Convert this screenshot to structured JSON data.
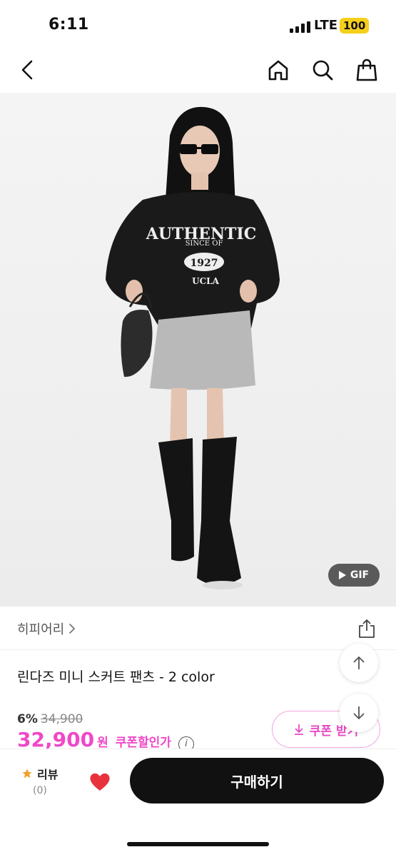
{
  "status_bar": {
    "time": "6:11",
    "network": "LTE",
    "battery": "100"
  },
  "nav": {
    "back_icon": "chevron-left",
    "home_icon": "home",
    "search_icon": "search",
    "cart_icon": "shopping-bag"
  },
  "hero": {
    "gif_label": "GIF",
    "shirt_line1": "AUTHENTIC",
    "shirt_line2": "SINCE OF",
    "shirt_line3": "1927",
    "shirt_line4": "UCLA"
  },
  "product": {
    "brand": "히피어리",
    "title": "린다즈 미니 스커트 팬츠 - 2 color",
    "discount_percent": "6%",
    "original_price": "34,900",
    "sale_price": "32,900",
    "currency": "원",
    "coupon_discount_label": "쿠폰할인가",
    "coupon_button": "쿠폰 받기"
  },
  "bottom_bar": {
    "review_label": "리뷰",
    "review_count": "(0)",
    "buy_label": "구매하기"
  },
  "colors": {
    "accent_pink": "#f048c8",
    "buy_button": "#111111",
    "gif_badge": "#5a5a5a",
    "heart": "#e8333d",
    "star": "#f0a12b"
  }
}
